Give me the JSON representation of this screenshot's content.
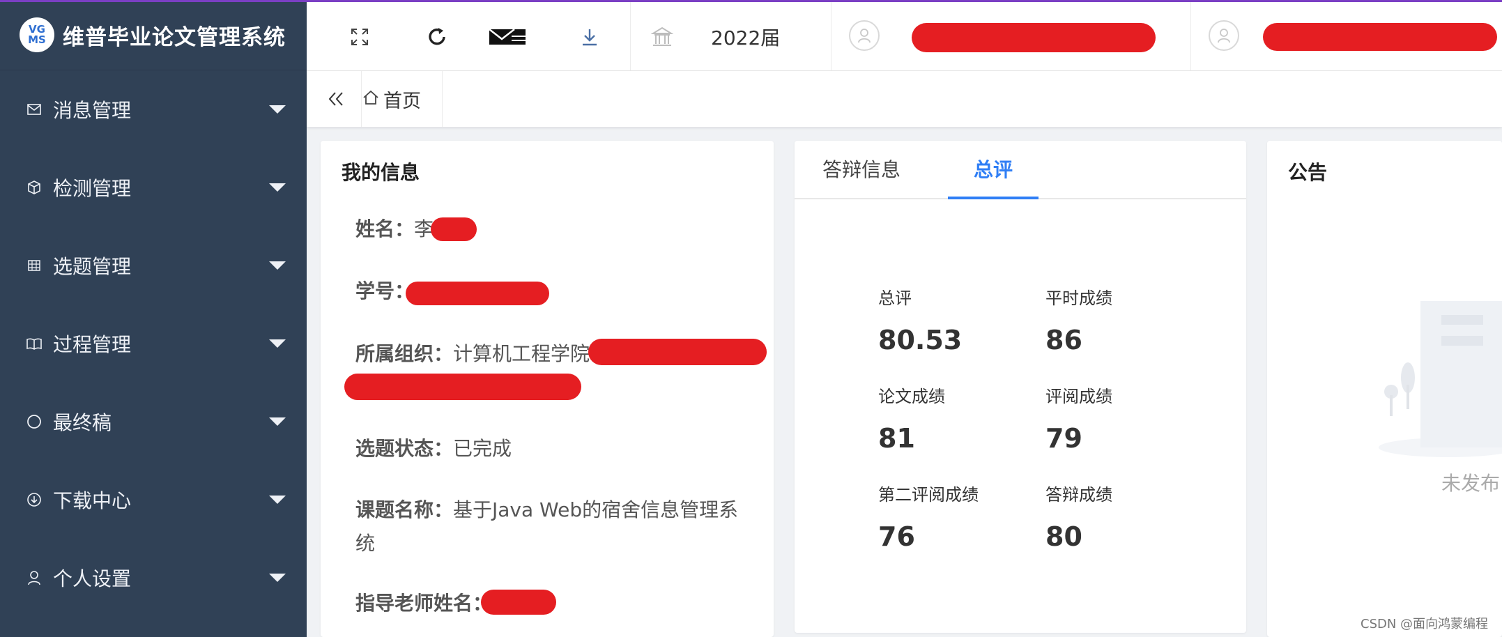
{
  "brand": {
    "logo_top": "VG",
    "logo_bottom": "MS",
    "title": "维普毕业论文管理系统"
  },
  "sidebar": {
    "items": [
      {
        "label": "消息管理",
        "icon": "mail-icon"
      },
      {
        "label": "检测管理",
        "icon": "cube-icon"
      },
      {
        "label": "选题管理",
        "icon": "grid-icon"
      },
      {
        "label": "过程管理",
        "icon": "book-icon"
      },
      {
        "label": "最终稿",
        "icon": "circle-icon"
      },
      {
        "label": "下载中心",
        "icon": "download-circle-icon"
      },
      {
        "label": "个人设置",
        "icon": "user-icon"
      }
    ]
  },
  "header": {
    "year": "2022届"
  },
  "tags": {
    "home": "首页"
  },
  "my_info": {
    "title": "我的信息",
    "name_label": "姓名：",
    "name_value": "李",
    "student_id_label": "学号：",
    "org_label": "所属组织：",
    "org_value": "计算机工程学院",
    "topic_status_label": "选题状态：",
    "topic_status_value": "已完成",
    "topic_name_label": "课题名称：",
    "topic_name_value_line1": "基于Java Web的宿舍信息管理系",
    "topic_name_value_line2": "统",
    "advisor_label": "指导老师姓名："
  },
  "scores": {
    "tabs": [
      "答辩信息",
      "总评"
    ],
    "active_tab": 1,
    "items": [
      {
        "label": "总评",
        "value": "80.53"
      },
      {
        "label": "平时成绩",
        "value": "86"
      },
      {
        "label": "论文成绩",
        "value": "81"
      },
      {
        "label": "评阅成绩",
        "value": "79"
      },
      {
        "label": "第二评阅成绩",
        "value": "76"
      },
      {
        "label": "答辩成绩",
        "value": "80"
      }
    ]
  },
  "announcement": {
    "title": "公告",
    "empty_text": "未发布"
  },
  "watermark": "CSDN @面向鸿蒙编程",
  "colors": {
    "sidebar_bg": "#304156",
    "accent": "#2f7ef5",
    "redaction": "#e51e22"
  }
}
